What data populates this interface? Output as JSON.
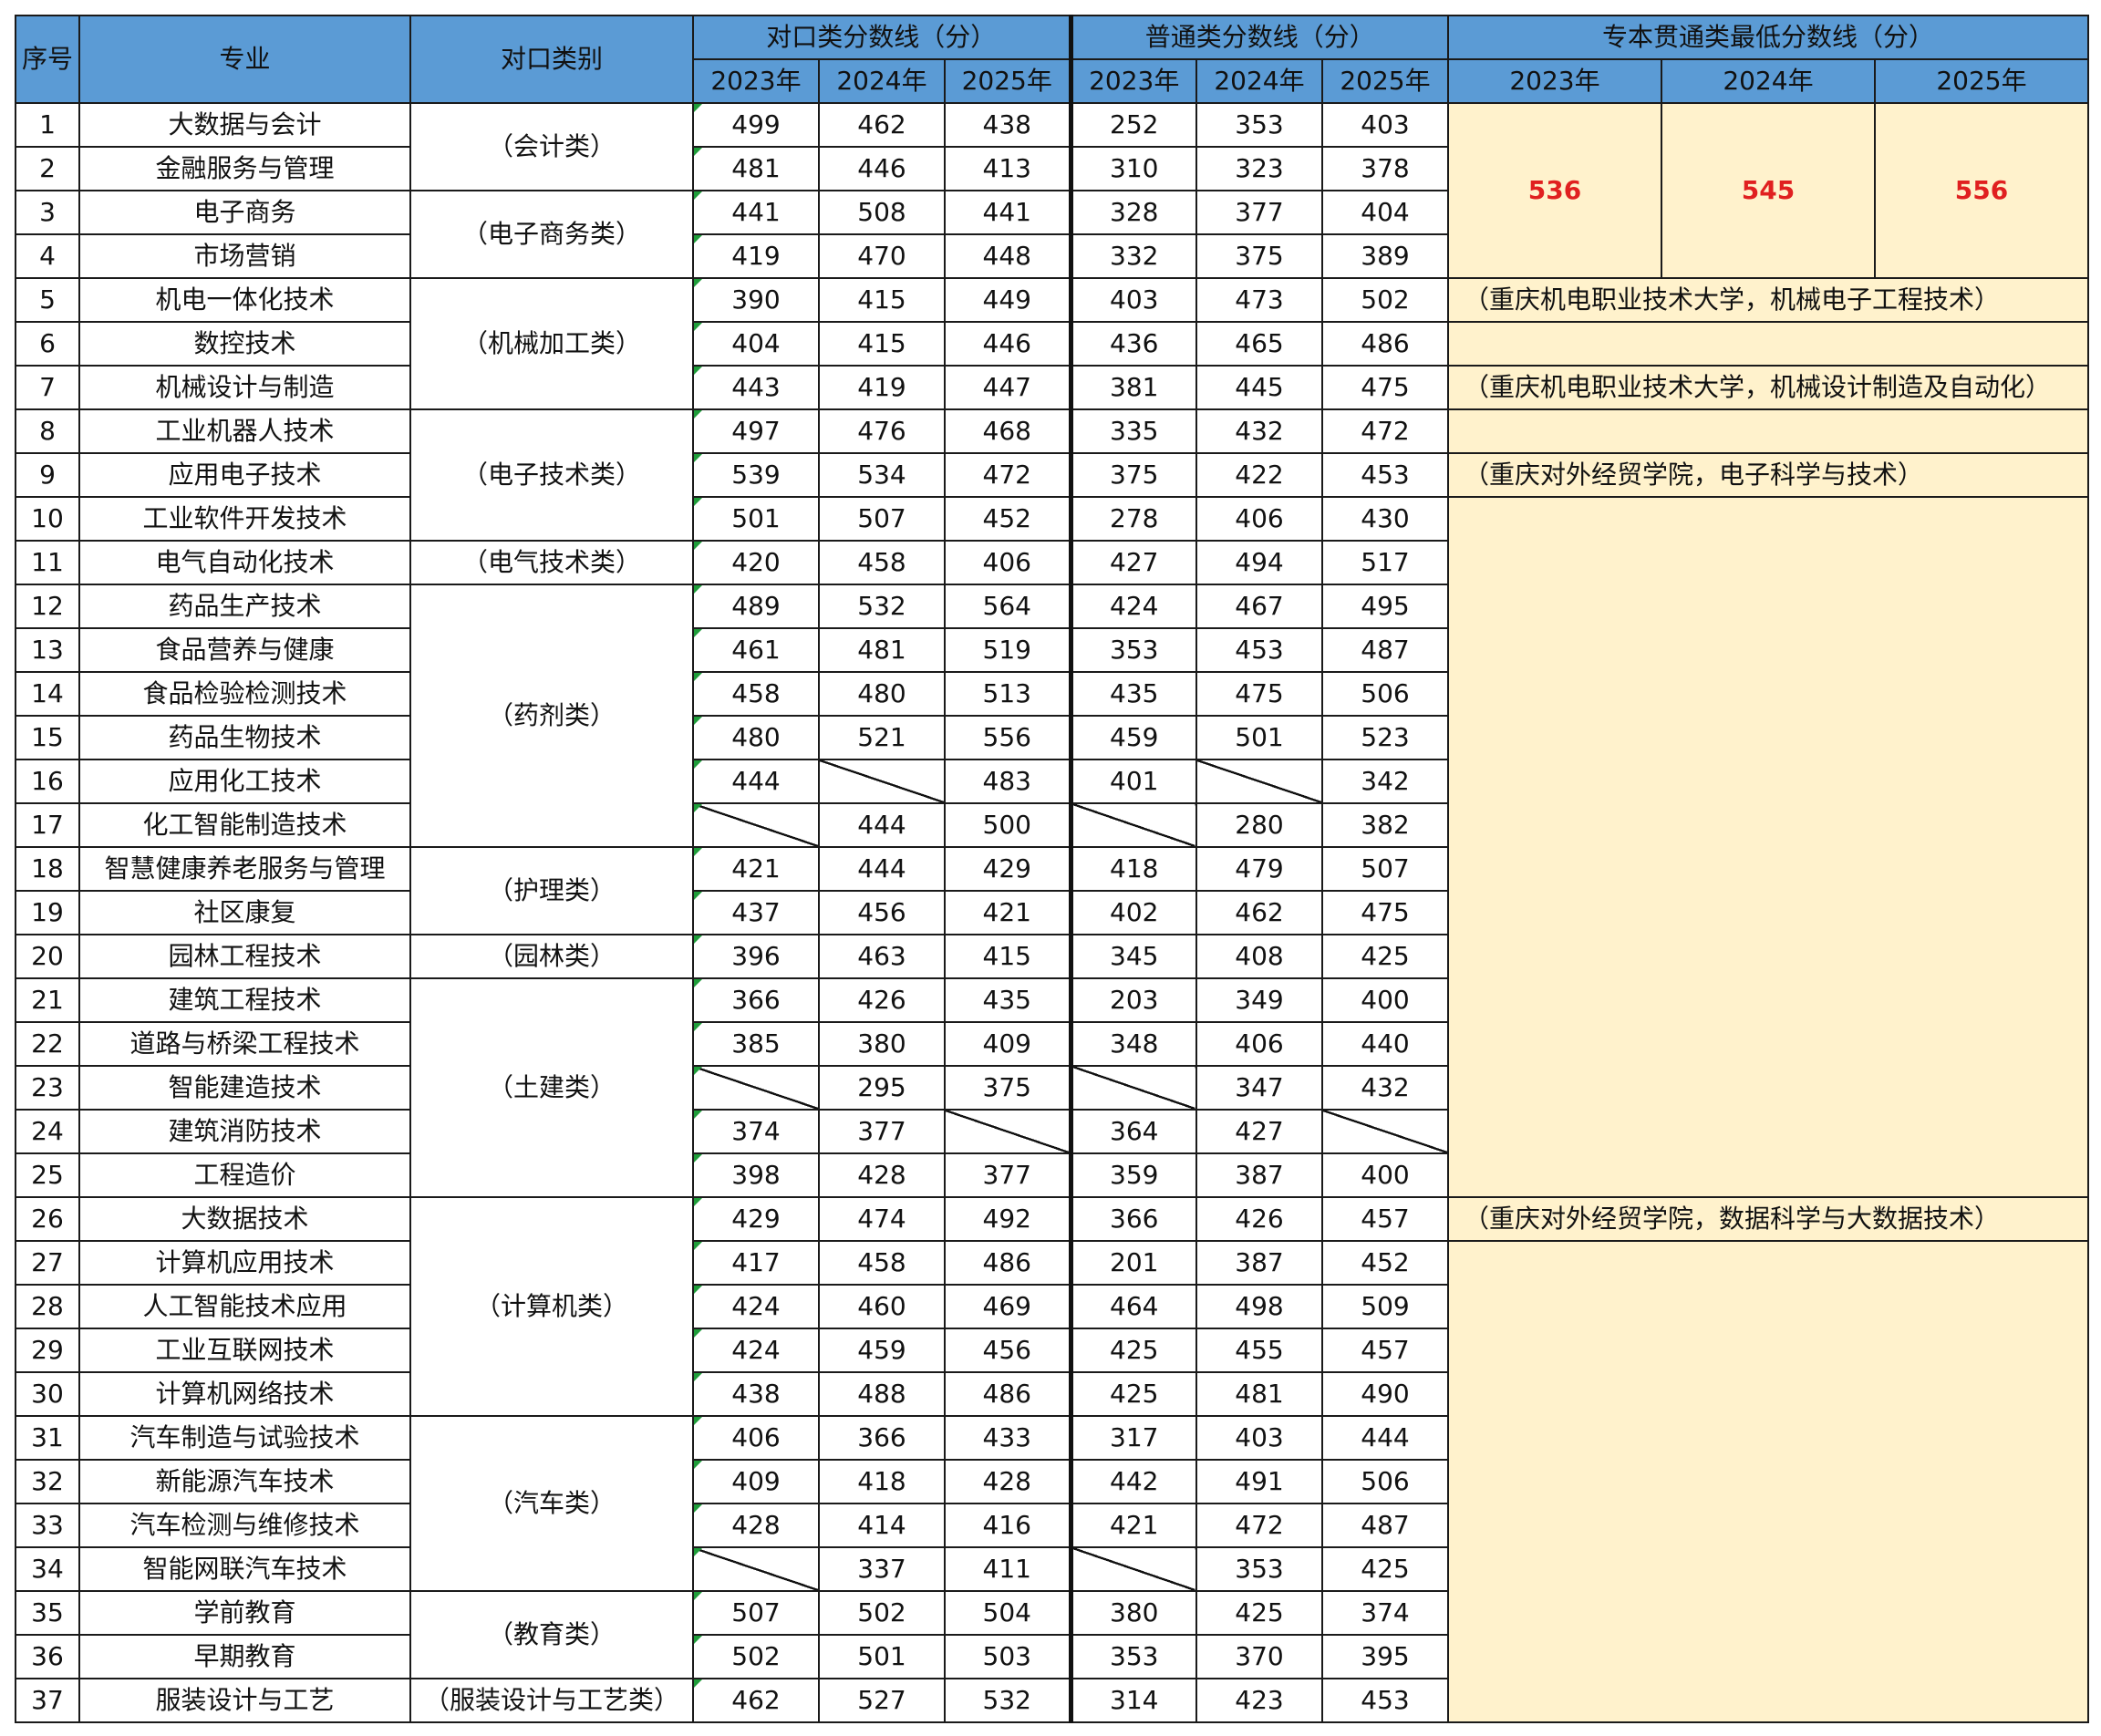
{
  "header": {
    "seq": "序号",
    "major": "专业",
    "category": "对口类别",
    "group_duikou": "对口类分数线（分）",
    "group_putong": "普通类分数线（分）",
    "group_zhuanben": "专本贯通类最低分数线（分）",
    "years": [
      "2023年",
      "2024年",
      "2025年"
    ]
  },
  "zhuanben_scores": [
    "536",
    "545",
    "556"
  ],
  "notes": {
    "r5": "（重庆机电职业技术大学，机械电子工程技术）",
    "r7": "（重庆机电职业技术大学，机械设计制造及自动化）",
    "r9": "（重庆对外经贸学院，电子科学与技术）",
    "r26": "（重庆对外经贸学院，数据科学与大数据技术）"
  },
  "categories": {
    "kuaiji": "（会计类）",
    "dianzishangwu": "（电子商务类）",
    "jixie": "（机械加工类）",
    "dianzijishu": "（电子技术类）",
    "dianqi": "（电气技术类）",
    "yaoji": "（药剂类）",
    "huli": "（护理类）",
    "yuanlin": "（园林类）",
    "tujian": "（土建类）",
    "jisuanji": "（计算机类）",
    "qiche": "（汽车类）",
    "jiaoyu": "（教育类）",
    "fuzhuang": "（服装设计与工艺类）"
  },
  "rows": [
    {
      "no": "1",
      "major": "大数据与会计",
      "d": [
        "499",
        "462",
        "438"
      ],
      "p": [
        "252",
        "353",
        "403"
      ]
    },
    {
      "no": "2",
      "major": "金融服务与管理",
      "d": [
        "481",
        "446",
        "413"
      ],
      "p": [
        "310",
        "323",
        "378"
      ]
    },
    {
      "no": "3",
      "major": "电子商务",
      "d": [
        "441",
        "508",
        "441"
      ],
      "p": [
        "328",
        "377",
        "404"
      ]
    },
    {
      "no": "4",
      "major": "市场营销",
      "d": [
        "419",
        "470",
        "448"
      ],
      "p": [
        "332",
        "375",
        "389"
      ]
    },
    {
      "no": "5",
      "major": "机电一体化技术",
      "d": [
        "390",
        "415",
        "449"
      ],
      "p": [
        "403",
        "473",
        "502"
      ]
    },
    {
      "no": "6",
      "major": "数控技术",
      "d": [
        "404",
        "415",
        "446"
      ],
      "p": [
        "436",
        "465",
        "486"
      ]
    },
    {
      "no": "7",
      "major": "机械设计与制造",
      "d": [
        "443",
        "419",
        "447"
      ],
      "p": [
        "381",
        "445",
        "475"
      ]
    },
    {
      "no": "8",
      "major": "工业机器人技术",
      "d": [
        "497",
        "476",
        "468"
      ],
      "p": [
        "335",
        "432",
        "472"
      ]
    },
    {
      "no": "9",
      "major": "应用电子技术",
      "d": [
        "539",
        "534",
        "472"
      ],
      "p": [
        "375",
        "422",
        "453"
      ]
    },
    {
      "no": "10",
      "major": "工业软件开发技术",
      "d": [
        "501",
        "507",
        "452"
      ],
      "p": [
        "278",
        "406",
        "430"
      ]
    },
    {
      "no": "11",
      "major": "电气自动化技术",
      "d": [
        "420",
        "458",
        "406"
      ],
      "p": [
        "427",
        "494",
        "517"
      ]
    },
    {
      "no": "12",
      "major": "药品生产技术",
      "d": [
        "489",
        "532",
        "564"
      ],
      "p": [
        "424",
        "467",
        "495"
      ]
    },
    {
      "no": "13",
      "major": "食品营养与健康",
      "d": [
        "461",
        "481",
        "519"
      ],
      "p": [
        "353",
        "453",
        "487"
      ]
    },
    {
      "no": "14",
      "major": "食品检验检测技术",
      "d": [
        "458",
        "480",
        "513"
      ],
      "p": [
        "435",
        "475",
        "506"
      ]
    },
    {
      "no": "15",
      "major": "药品生物技术",
      "d": [
        "480",
        "521",
        "556"
      ],
      "p": [
        "459",
        "501",
        "523"
      ]
    },
    {
      "no": "16",
      "major": "应用化工技术",
      "d": [
        "444",
        "",
        "483"
      ],
      "p": [
        "401",
        "",
        "342"
      ]
    },
    {
      "no": "17",
      "major": "化工智能制造技术",
      "d": [
        "",
        "444",
        "500"
      ],
      "p": [
        "",
        "280",
        "382"
      ]
    },
    {
      "no": "18",
      "major": "智慧健康养老服务与管理",
      "d": [
        "421",
        "444",
        "429"
      ],
      "p": [
        "418",
        "479",
        "507"
      ]
    },
    {
      "no": "19",
      "major": "社区康复",
      "d": [
        "437",
        "456",
        "421"
      ],
      "p": [
        "402",
        "462",
        "475"
      ]
    },
    {
      "no": "20",
      "major": "园林工程技术",
      "d": [
        "396",
        "463",
        "415"
      ],
      "p": [
        "345",
        "408",
        "425"
      ]
    },
    {
      "no": "21",
      "major": "建筑工程技术",
      "d": [
        "366",
        "426",
        "435"
      ],
      "p": [
        "203",
        "349",
        "400"
      ]
    },
    {
      "no": "22",
      "major": "道路与桥梁工程技术",
      "d": [
        "385",
        "380",
        "409"
      ],
      "p": [
        "348",
        "406",
        "440"
      ]
    },
    {
      "no": "23",
      "major": "智能建造技术",
      "d": [
        "",
        "295",
        "375"
      ],
      "p": [
        "",
        "347",
        "432"
      ]
    },
    {
      "no": "24",
      "major": "建筑消防技术",
      "d": [
        "374",
        "377",
        ""
      ],
      "p": [
        "364",
        "427",
        ""
      ]
    },
    {
      "no": "25",
      "major": "工程造价",
      "d": [
        "398",
        "428",
        "377"
      ],
      "p": [
        "359",
        "387",
        "400"
      ]
    },
    {
      "no": "26",
      "major": "大数据技术",
      "d": [
        "429",
        "474",
        "492"
      ],
      "p": [
        "366",
        "426",
        "457"
      ]
    },
    {
      "no": "27",
      "major": "计算机应用技术",
      "d": [
        "417",
        "458",
        "486"
      ],
      "p": [
        "201",
        "387",
        "452"
      ]
    },
    {
      "no": "28",
      "major": "人工智能技术应用",
      "d": [
        "424",
        "460",
        "469"
      ],
      "p": [
        "464",
        "498",
        "509"
      ]
    },
    {
      "no": "29",
      "major": "工业互联网技术",
      "d": [
        "424",
        "459",
        "456"
      ],
      "p": [
        "425",
        "455",
        "457"
      ]
    },
    {
      "no": "30",
      "major": "计算机网络技术",
      "d": [
        "438",
        "488",
        "486"
      ],
      "p": [
        "425",
        "481",
        "490"
      ]
    },
    {
      "no": "31",
      "major": "汽车制造与试验技术",
      "d": [
        "406",
        "366",
        "433"
      ],
      "p": [
        "317",
        "403",
        "444"
      ]
    },
    {
      "no": "32",
      "major": "新能源汽车技术",
      "d": [
        "409",
        "418",
        "428"
      ],
      "p": [
        "442",
        "491",
        "506"
      ]
    },
    {
      "no": "33",
      "major": "汽车检测与维修技术",
      "d": [
        "428",
        "414",
        "416"
      ],
      "p": [
        "421",
        "472",
        "487"
      ]
    },
    {
      "no": "34",
      "major": "智能网联汽车技术",
      "d": [
        "",
        "337",
        "411"
      ],
      "p": [
        "",
        "353",
        "425"
      ]
    },
    {
      "no": "35",
      "major": "学前教育",
      "d": [
        "507",
        "502",
        "504"
      ],
      "p": [
        "380",
        "425",
        "374"
      ]
    },
    {
      "no": "36",
      "major": "早期教育",
      "d": [
        "502",
        "501",
        "503"
      ],
      "p": [
        "353",
        "370",
        "395"
      ]
    },
    {
      "no": "37",
      "major": "服装设计与工艺",
      "d": [
        "462",
        "527",
        "532"
      ],
      "p": [
        "314",
        "423",
        "453"
      ]
    }
  ]
}
